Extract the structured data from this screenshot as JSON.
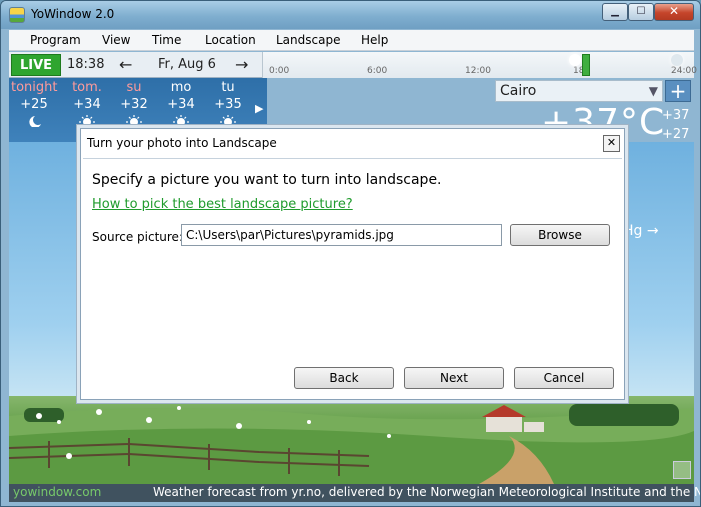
{
  "window": {
    "title": "YoWindow 2.0",
    "min_glyph": "▁",
    "max_glyph": "☐",
    "close_glyph": "✕"
  },
  "menu": [
    "Program",
    "View",
    "Time",
    "Location",
    "Landscape",
    "Help"
  ],
  "timebar": {
    "live": "LIVE",
    "time": "18:38",
    "prev_arrow": "←",
    "next_arrow": "→",
    "date": "Fr, Aug 6",
    "ticks": [
      "0:00",
      "6:00",
      "12:00",
      "18:",
      "24:00"
    ]
  },
  "forecast": [
    {
      "label": "tonight",
      "temp": "+25",
      "color": "#ff9b9b"
    },
    {
      "label": "tom.",
      "temp": "+34",
      "color": "#ff9b9b"
    },
    {
      "label": "su",
      "temp": "+32",
      "color": "#ff9b9b"
    },
    {
      "label": "mo",
      "temp": "+34",
      "color": "#ffffff"
    },
    {
      "label": "tu",
      "temp": "+35",
      "color": "#ffffff"
    }
  ],
  "forecast_next": "▶",
  "city": {
    "name": "Cairo",
    "dropdown": "▼",
    "add": "+",
    "temperature": "+37°C",
    "high": "+37",
    "low": "+27",
    "pressure_fragment": "Hg →"
  },
  "dialog": {
    "title": "Turn your photo into Landscape",
    "close": "✕",
    "instruction": "Specify a picture you want to turn into landscape.",
    "help_link": "How to pick the best landscape picture?",
    "source_label": "Source picture:",
    "source_value": "C:\\Users\\par\\Pictures\\pyramids.jpg",
    "browse": "Browse",
    "back": "Back",
    "next": "Next",
    "cancel": "Cancel"
  },
  "footer": {
    "site": "yowindow.com",
    "credit": "Weather forecast from yr.no, delivered by the Norwegian Meteorological Institute and the NRK"
  },
  "colors": {
    "live_green": "#2fa52f",
    "link_green": "#1f9b2c",
    "warm_day": "#ff9b9b"
  }
}
